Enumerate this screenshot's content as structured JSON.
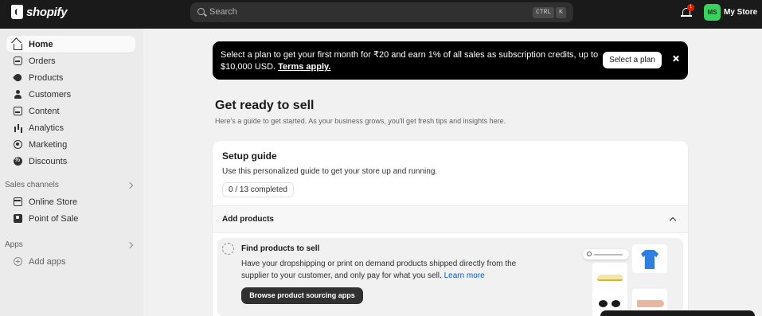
{
  "topbar": {
    "brand": "shopify",
    "search_placeholder": "Search",
    "shortcut_keys": [
      "CTRL",
      "K"
    ],
    "notification_count": "1",
    "avatar_initials": "MS",
    "store_name": "My Store"
  },
  "sidebar": {
    "items": [
      {
        "label": "Home",
        "icon": "home-icon",
        "active": true
      },
      {
        "label": "Orders",
        "icon": "orders-icon"
      },
      {
        "label": "Products",
        "icon": "tag-icon"
      },
      {
        "label": "Customers",
        "icon": "person-icon"
      },
      {
        "label": "Content",
        "icon": "content-icon"
      },
      {
        "label": "Analytics",
        "icon": "bar-chart-icon"
      },
      {
        "label": "Marketing",
        "icon": "target-icon"
      },
      {
        "label": "Discounts",
        "icon": "discount-icon"
      }
    ],
    "sales_channels_title": "Sales channels",
    "sales_channels": [
      {
        "label": "Online Store",
        "icon": "store-icon"
      },
      {
        "label": "Point of Sale",
        "icon": "pos-icon"
      }
    ],
    "apps_title": "Apps",
    "add_apps_label": "Add apps"
  },
  "banner": {
    "text": "Select a plan to get your first month for ₹20 and earn 1% of all sales as subscription credits, up to $10,000 USD. ",
    "link": "Terms apply.",
    "button": "Select a plan"
  },
  "main": {
    "title": "Get ready to sell",
    "subtitle": "Here's a guide to get started. As your business grows, you'll get fresh tips and insights here."
  },
  "setup_guide": {
    "title": "Setup guide",
    "description": "Use this personalized guide to get your store up and running.",
    "progress": "0 / 13 completed",
    "section": "Add products",
    "task": {
      "title": "Find products to sell",
      "description": "Have your dropshipping or print on demand products shipped directly from the supplier to your customer, and only pay for what you sell. ",
      "link": "Learn more",
      "button": "Browse product sourcing apps"
    }
  },
  "colors": {
    "topbar": "#1a1a1a",
    "avatar": "#3ad15f",
    "banner": "#000000",
    "link": "#005bd3",
    "badge": "#e51c00"
  }
}
